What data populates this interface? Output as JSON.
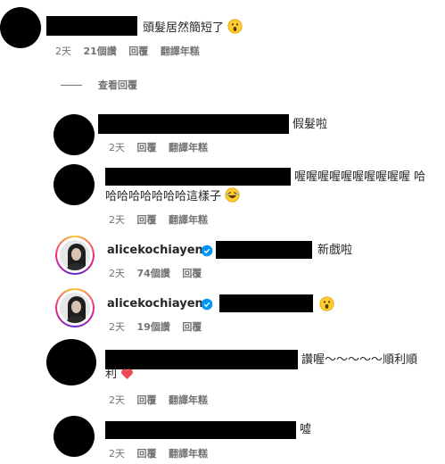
{
  "comment1": {
    "text": "頭髮居然簡短了",
    "meta": [
      "2天",
      "21個讚",
      "回覆",
      "翻譯年糕"
    ]
  },
  "view_replies": "查看回覆",
  "reply1": {
    "text": "假髮啦",
    "meta": [
      "2天",
      "回覆",
      "翻譯年糕"
    ]
  },
  "reply2": {
    "text_line1": "喔喔喔喔喔喔喔喔喔喔 哈",
    "text_line2": "哈哈哈哈哈哈哈這樣子",
    "meta": [
      "2天",
      "回覆",
      "翻譯年糕"
    ]
  },
  "reply3": {
    "username": "alicekochiayen",
    "text": "新戲啦",
    "meta": [
      "2天",
      "74個讚",
      "回覆"
    ]
  },
  "reply4": {
    "username": "alicekochiayen",
    "meta": [
      "2天",
      "19個讚",
      "回覆"
    ]
  },
  "reply5": {
    "text_line1": "讚喔～～～～～順利順",
    "text_line2": "利",
    "meta": [
      "2天",
      "回覆",
      "翻譯年糕"
    ]
  },
  "reply6": {
    "text": "噓",
    "meta": [
      "2天",
      "回覆",
      "翻譯年糕"
    ]
  },
  "colors": {
    "verified": "#0095f6",
    "meta_text": "#737373",
    "heart": "#ed4956"
  }
}
